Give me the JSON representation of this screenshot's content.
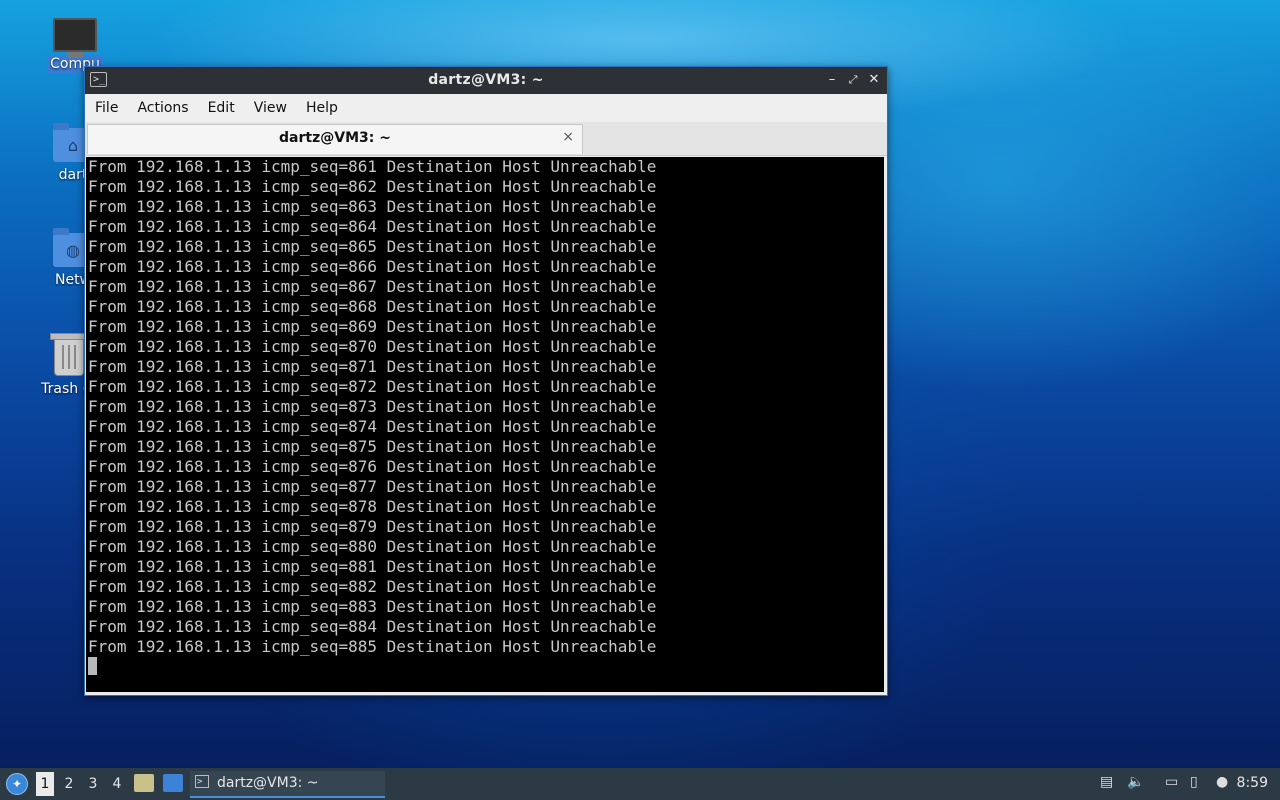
{
  "desktop": {
    "icons": [
      {
        "label": "Compu"
      },
      {
        "label": "dart"
      },
      {
        "label": "Netw"
      },
      {
        "label": "Trash (E"
      }
    ]
  },
  "window": {
    "title": "dartz@VM3: ~",
    "menu": [
      "File",
      "Actions",
      "Edit",
      "View",
      "Help"
    ],
    "tab_title": "dartz@VM3: ~",
    "tab_close": "×",
    "terminal_lines": [
      "From 192.168.1.13 icmp_seq=861 Destination Host Unreachable",
      "From 192.168.1.13 icmp_seq=862 Destination Host Unreachable",
      "From 192.168.1.13 icmp_seq=863 Destination Host Unreachable",
      "From 192.168.1.13 icmp_seq=864 Destination Host Unreachable",
      "From 192.168.1.13 icmp_seq=865 Destination Host Unreachable",
      "From 192.168.1.13 icmp_seq=866 Destination Host Unreachable",
      "From 192.168.1.13 icmp_seq=867 Destination Host Unreachable",
      "From 192.168.1.13 icmp_seq=868 Destination Host Unreachable",
      "From 192.168.1.13 icmp_seq=869 Destination Host Unreachable",
      "From 192.168.1.13 icmp_seq=870 Destination Host Unreachable",
      "From 192.168.1.13 icmp_seq=871 Destination Host Unreachable",
      "From 192.168.1.13 icmp_seq=872 Destination Host Unreachable",
      "From 192.168.1.13 icmp_seq=873 Destination Host Unreachable",
      "From 192.168.1.13 icmp_seq=874 Destination Host Unreachable",
      "From 192.168.1.13 icmp_seq=875 Destination Host Unreachable",
      "From 192.168.1.13 icmp_seq=876 Destination Host Unreachable",
      "From 192.168.1.13 icmp_seq=877 Destination Host Unreachable",
      "From 192.168.1.13 icmp_seq=878 Destination Host Unreachable",
      "From 192.168.1.13 icmp_seq=879 Destination Host Unreachable",
      "From 192.168.1.13 icmp_seq=880 Destination Host Unreachable",
      "From 192.168.1.13 icmp_seq=881 Destination Host Unreachable",
      "From 192.168.1.13 icmp_seq=882 Destination Host Unreachable",
      "From 192.168.1.13 icmp_seq=883 Destination Host Unreachable",
      "From 192.168.1.13 icmp_seq=884 Destination Host Unreachable",
      "From 192.168.1.13 icmp_seq=885 Destination Host Unreachable"
    ]
  },
  "taskbar": {
    "workspaces": [
      "1",
      "2",
      "3",
      "4"
    ],
    "active_workspace": "1",
    "task_label": "dartz@VM3: ~",
    "clock": "8:59",
    "accent": "#4a90d9"
  },
  "colors": {
    "titlebar": "#2d3136",
    "terminal_bg": "#000000",
    "terminal_fg": "#c8c8c8",
    "window_border": "#2d6fbf"
  }
}
